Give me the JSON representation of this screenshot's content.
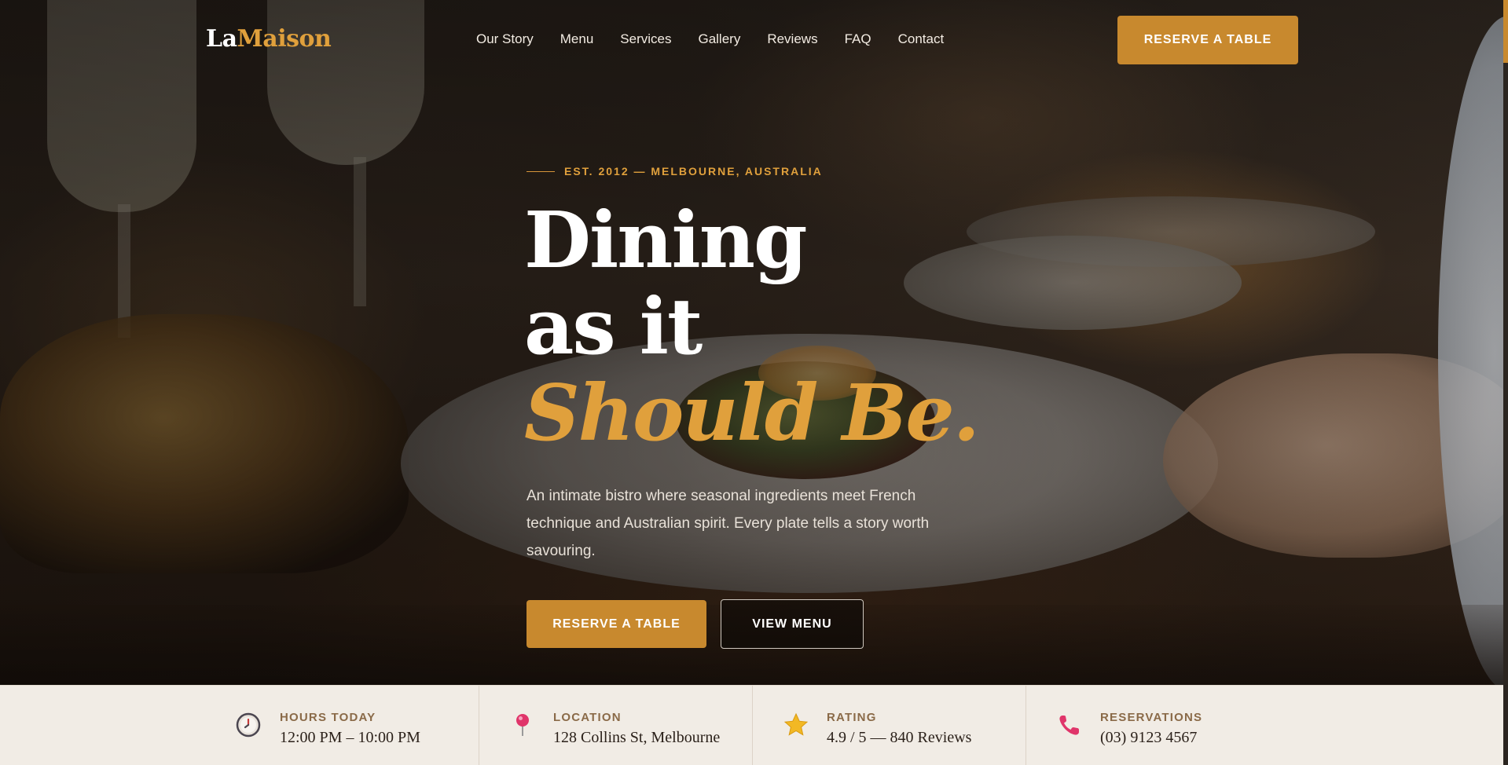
{
  "brand": {
    "logo_part1": "La",
    "logo_part2": "Maison",
    "accent_color": "#c8892e"
  },
  "nav": {
    "links": [
      "Our Story",
      "Menu",
      "Services",
      "Gallery",
      "Reviews",
      "FAQ",
      "Contact"
    ],
    "cta": "RESERVE A TABLE"
  },
  "hero": {
    "eyebrow": "EST. 2012 — MELBOURNE, AUSTRALIA",
    "headline_line1": "Dining",
    "headline_line2": "as it",
    "headline_line3": "Should Be.",
    "lede": "An intimate bistro where seasonal ingredients meet French technique and Australian spirit. Every plate tells a story worth savouring.",
    "primary_button": "RESERVE A TABLE",
    "secondary_button": "VIEW MENU"
  },
  "info": [
    {
      "label": "HOURS TODAY",
      "value": "12:00 PM – 10:00 PM",
      "icon": "clock-icon"
    },
    {
      "label": "LOCATION",
      "value": "128 Collins St, Melbourne",
      "icon": "map-pin-icon"
    },
    {
      "label": "RATING",
      "value": "4.9 / 5 — 840 Reviews",
      "icon": "star-icon"
    },
    {
      "label": "RESERVATIONS",
      "value": "(03) 9123 4567",
      "icon": "phone-icon"
    }
  ]
}
